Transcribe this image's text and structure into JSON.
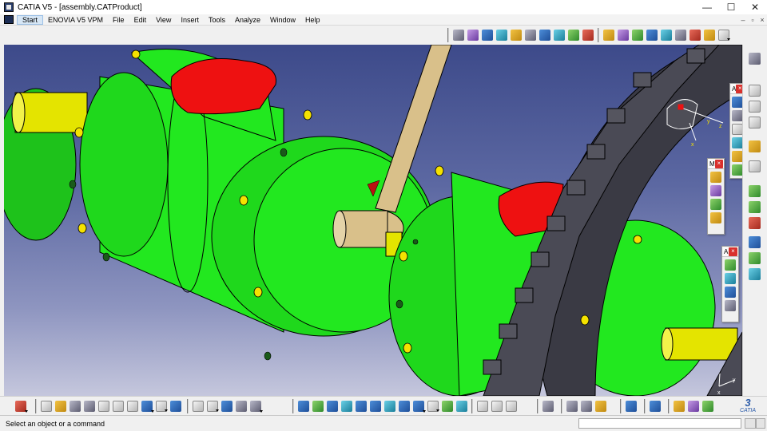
{
  "window": {
    "title": "CATIA V5 - [assembly.CATProduct]",
    "controls": {
      "minimize": "—",
      "maximize": "☐",
      "close": "✕"
    }
  },
  "menubar": {
    "items": [
      "Start",
      "ENOVIA V5 VPM",
      "File",
      "Edit",
      "View",
      "Insert",
      "Tools",
      "Analyze",
      "Window",
      "Help"
    ],
    "mdi_controls": {
      "minimize": "–",
      "restore": "▫",
      "close": "×"
    }
  },
  "palettes": {
    "top": {
      "label": "A"
    },
    "middle": {
      "label": "M"
    },
    "lower": {
      "label": "A"
    },
    "close_glyph": "×"
  },
  "viewport": {
    "compass": {
      "x_label": "x",
      "y_label": "y",
      "z_label": "z"
    },
    "axis_triad": {
      "x_label": "x",
      "y_label": "y"
    }
  },
  "branding": {
    "logo_text": "CATIA"
  },
  "statusbar": {
    "message": "Select an object or a command",
    "command_input_value": ""
  },
  "colors": {
    "part_green": "#22e81f",
    "part_red": "#ee1111",
    "shaft_yellow": "#e8e800",
    "rod_tan": "#d9c08a",
    "gear_dark": "#3a3a44",
    "background_top": "#3d4a8a",
    "background_bottom": "#c5c7dd"
  },
  "icons": {
    "top_toolbar": [
      "assembly-constraints-icon",
      "catalog-icon",
      "snap-icon",
      "manipulation-icon",
      "explode-icon",
      "clash-icon",
      "sectioning-icon",
      "distance-icon",
      "measure-icon",
      "product-icon",
      "fix-icon",
      "coincidence-icon",
      "contact-icon",
      "offset-icon",
      "angle-icon",
      "fix-together-icon",
      "update-icon",
      "component-icon"
    ],
    "bottom_toolbar": [
      "select-icon",
      "new-icon",
      "open-icon",
      "save-icon",
      "print-icon",
      "cut-icon",
      "copy-icon",
      "paste-icon",
      "undo-icon",
      "redo-icon",
      "whats-this-icon",
      "formula-icon",
      "comment-icon",
      "table-icon",
      "knowledge-icon",
      "tree-icon",
      "pan-icon",
      "fit-all-icon",
      "rotate-icon",
      "zoom-in-icon",
      "zoom-out-icon",
      "normal-view-icon",
      "view-icon",
      "shading-icon",
      "hide-show-icon",
      "swap-icon",
      "measure-between-icon",
      "measure-item-icon",
      "inertia-icon",
      "fly-icon",
      "walk-icon",
      "camera-icon",
      "render-icon"
    ]
  }
}
